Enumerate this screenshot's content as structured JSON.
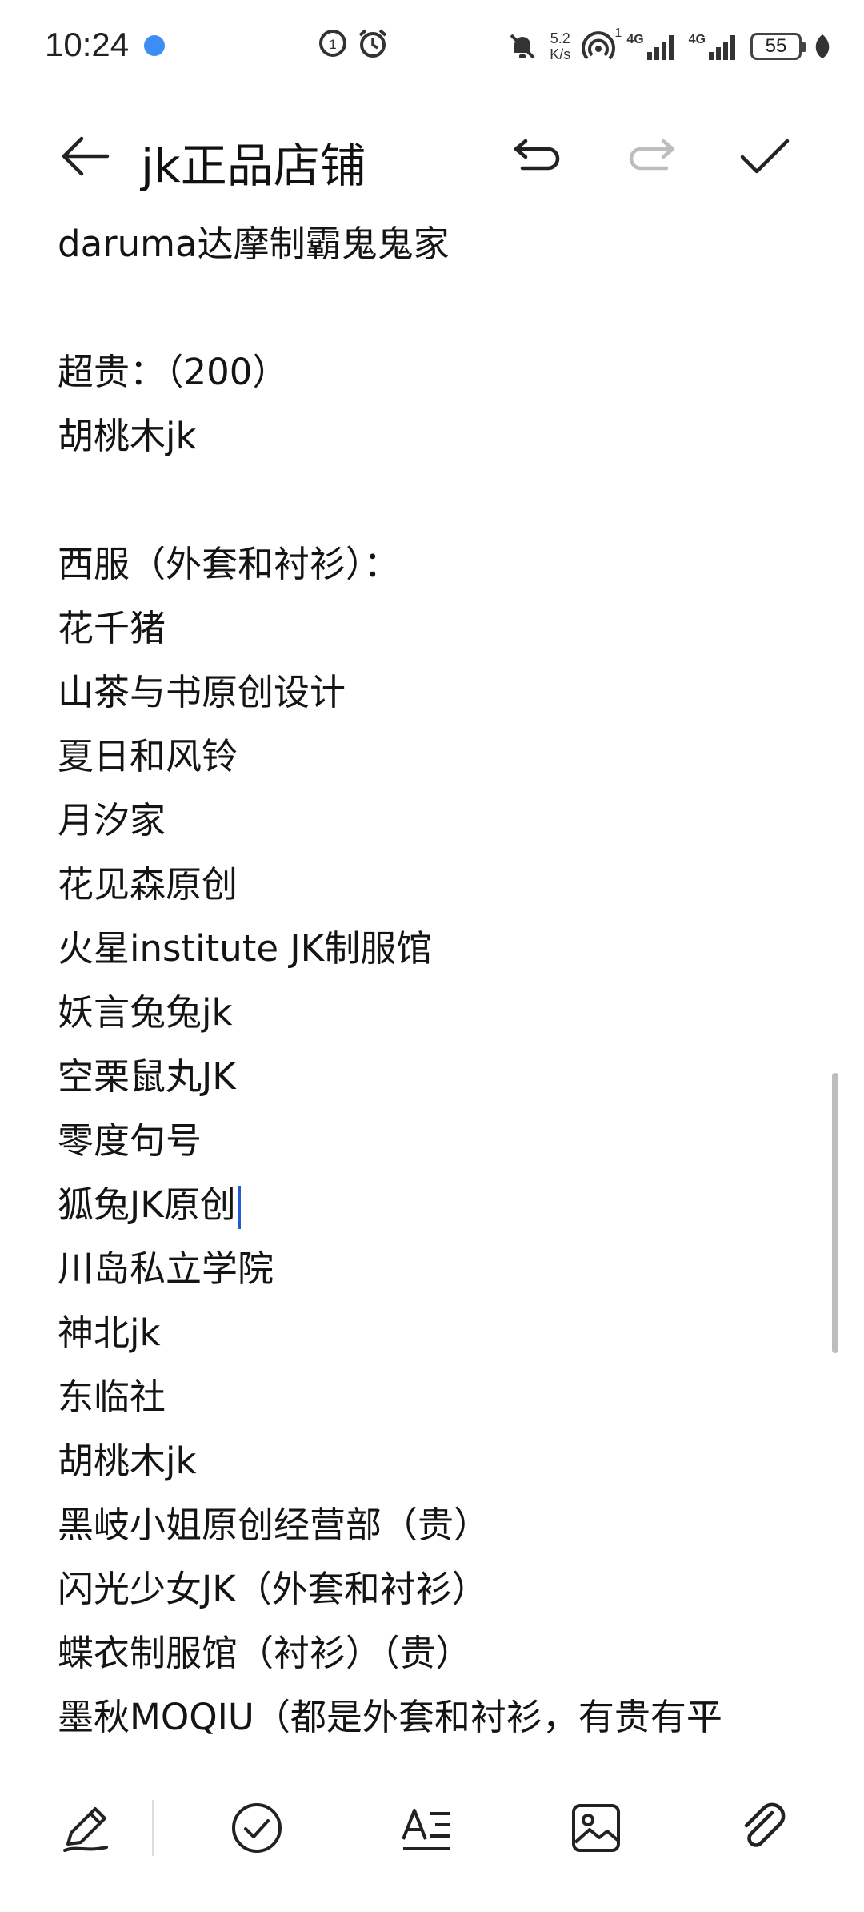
{
  "status": {
    "time": "10:24",
    "net_speed_value": "5.2",
    "net_speed_unit": "K/s",
    "sim1_label": "4G",
    "sim2_label": "4G",
    "hotspot_badge": "1",
    "battery": "55"
  },
  "toolbar": {
    "title": "jk正品店铺"
  },
  "note": {
    "lines": [
      "daruma达摩制霸鬼鬼家",
      "",
      "超贵：（200）",
      "胡桃木jk",
      "",
      "西服（外套和衬衫）：",
      "花千猪",
      "山茶与书原创设计",
      "夏日和风铃",
      "月汐家",
      "花见森原创",
      "火星institute  JK制服馆",
      "妖言兔兔jk",
      "空栗鼠丸JK",
      "零度句号",
      "狐兔JK原创",
      "川岛私立学院",
      "神北jk",
      "东临社",
      "胡桃木jk",
      "黑岐小姐原创经营部（贵）",
      "闪光少女JK（外套和衬衫）",
      "蝶衣制服馆（衬衫）（贵）",
      "墨秋MOQIU（都是外套和衬衫，有贵有平"
    ]
  },
  "colors": {
    "accent": "#1f5bd6",
    "text": "#141414",
    "icon": "#222222",
    "disabled_icon": "#bdbdbd"
  }
}
